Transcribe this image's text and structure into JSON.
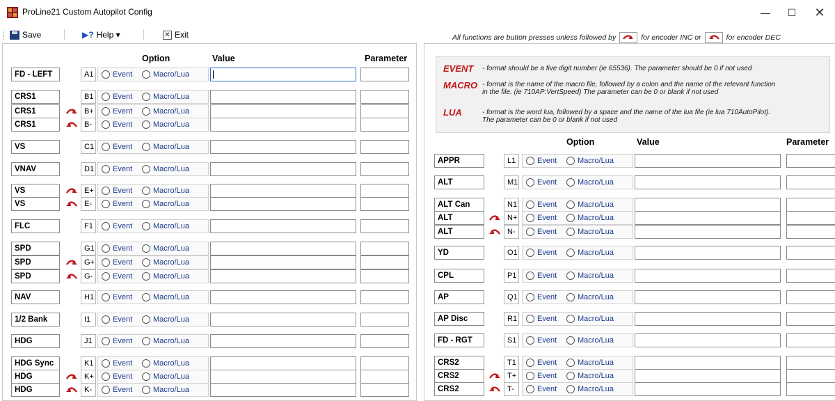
{
  "window": {
    "title": "ProLine21 Custom Autopilot Config",
    "min_glyph": "—",
    "max_glyph": "☐",
    "close_glyph": "✕"
  },
  "menu": {
    "save_label": "Save",
    "help_label": "Help ▾",
    "exit_label": "Exit"
  },
  "note": {
    "part1": "All functions are button presses unless followed by",
    "part2": "for encoder INC or",
    "part3": "for encoder DEC"
  },
  "columns": {
    "option": "Option",
    "value": "Value",
    "parameter": "Parameter"
  },
  "options": {
    "event": "Event",
    "macro": "Macro/Lua"
  },
  "info": {
    "event_key": "EVENT",
    "event_text": "- format should be a five digit number (ie 65536).  The parameter should be 0 if not used",
    "macro_key": "MACRO",
    "macro_text1": "- format is the name of the macro file, followed by a colon and the name of the relevant function",
    "macro_text2": "in the file.  (ie 710AP:VertSpeed)  The parameter can be 0 or blank if not used",
    "lua_key": "LUA",
    "lua_text1": "- format is the word lua, followed by a space and the name of the lua file (ie lua 710AutoPilot).",
    "lua_text2": "The parameter can be 0 or blank if not used"
  },
  "colors": {
    "encoder_arrow": "#c0181c",
    "radio_text": "#1b3a8c",
    "info_key": "#c01717"
  },
  "left_rows": [
    {
      "label": "FD - LEFT",
      "dir": "",
      "code": "A1",
      "value": "",
      "param": ""
    },
    {
      "label": "CRS1",
      "dir": "",
      "code": "B1",
      "value": "",
      "param": ""
    },
    {
      "label": "CRS1",
      "dir": "inc",
      "code": "B+",
      "value": "",
      "param": ""
    },
    {
      "label": "CRS1",
      "dir": "dec",
      "code": "B-",
      "value": "",
      "param": ""
    },
    {
      "label": "VS",
      "dir": "",
      "code": "C1",
      "value": "",
      "param": ""
    },
    {
      "label": "VNAV",
      "dir": "",
      "code": "D1",
      "value": "",
      "param": ""
    },
    {
      "label": "VS",
      "dir": "inc",
      "code": "E+",
      "value": "",
      "param": ""
    },
    {
      "label": "VS",
      "dir": "dec",
      "code": "E-",
      "value": "",
      "param": ""
    },
    {
      "label": "FLC",
      "dir": "",
      "code": "F1",
      "value": "",
      "param": ""
    },
    {
      "label": "SPD",
      "dir": "",
      "code": "G1",
      "value": "",
      "param": ""
    },
    {
      "label": "SPD",
      "dir": "inc",
      "code": "G+",
      "value": "",
      "param": ""
    },
    {
      "label": "SPD",
      "dir": "dec",
      "code": "G-",
      "value": "",
      "param": ""
    },
    {
      "label": "NAV",
      "dir": "",
      "code": "H1",
      "value": "",
      "param": ""
    },
    {
      "label": "1/2 Bank",
      "dir": "",
      "code": "I1",
      "value": "",
      "param": ""
    },
    {
      "label": "HDG",
      "dir": "",
      "code": "J1",
      "value": "",
      "param": ""
    },
    {
      "label": "HDG Sync",
      "dir": "",
      "code": "K1",
      "value": "",
      "param": ""
    },
    {
      "label": "HDG",
      "dir": "inc",
      "code": "K+",
      "value": "",
      "param": ""
    },
    {
      "label": "HDG",
      "dir": "dec",
      "code": "K-",
      "value": "",
      "param": ""
    }
  ],
  "right_rows": [
    {
      "label": "APPR",
      "dir": "",
      "code": "L1",
      "value": "",
      "param": ""
    },
    {
      "label": "ALT",
      "dir": "",
      "code": "M1",
      "value": "",
      "param": ""
    },
    {
      "label": "ALT Can",
      "dir": "",
      "code": "N1",
      "value": "",
      "param": ""
    },
    {
      "label": "ALT",
      "dir": "inc",
      "code": "N+",
      "value": "",
      "param": ""
    },
    {
      "label": "ALT",
      "dir": "dec",
      "code": "N-",
      "value": "",
      "param": ""
    },
    {
      "label": "YD",
      "dir": "",
      "code": "O1",
      "value": "",
      "param": ""
    },
    {
      "label": "CPL",
      "dir": "",
      "code": "P1",
      "value": "",
      "param": ""
    },
    {
      "label": "AP",
      "dir": "",
      "code": "Q1",
      "value": "",
      "param": ""
    },
    {
      "label": "AP Disc",
      "dir": "",
      "code": "R1",
      "value": "",
      "param": ""
    },
    {
      "label": "FD - RGT",
      "dir": "",
      "code": "S1",
      "value": "",
      "param": ""
    },
    {
      "label": "CRS2",
      "dir": "",
      "code": "T1",
      "value": "",
      "param": ""
    },
    {
      "label": "CRS2",
      "dir": "inc",
      "code": "T+",
      "value": "",
      "param": ""
    },
    {
      "label": "CRS2",
      "dir": "dec",
      "code": "T-",
      "value": "",
      "param": ""
    }
  ]
}
